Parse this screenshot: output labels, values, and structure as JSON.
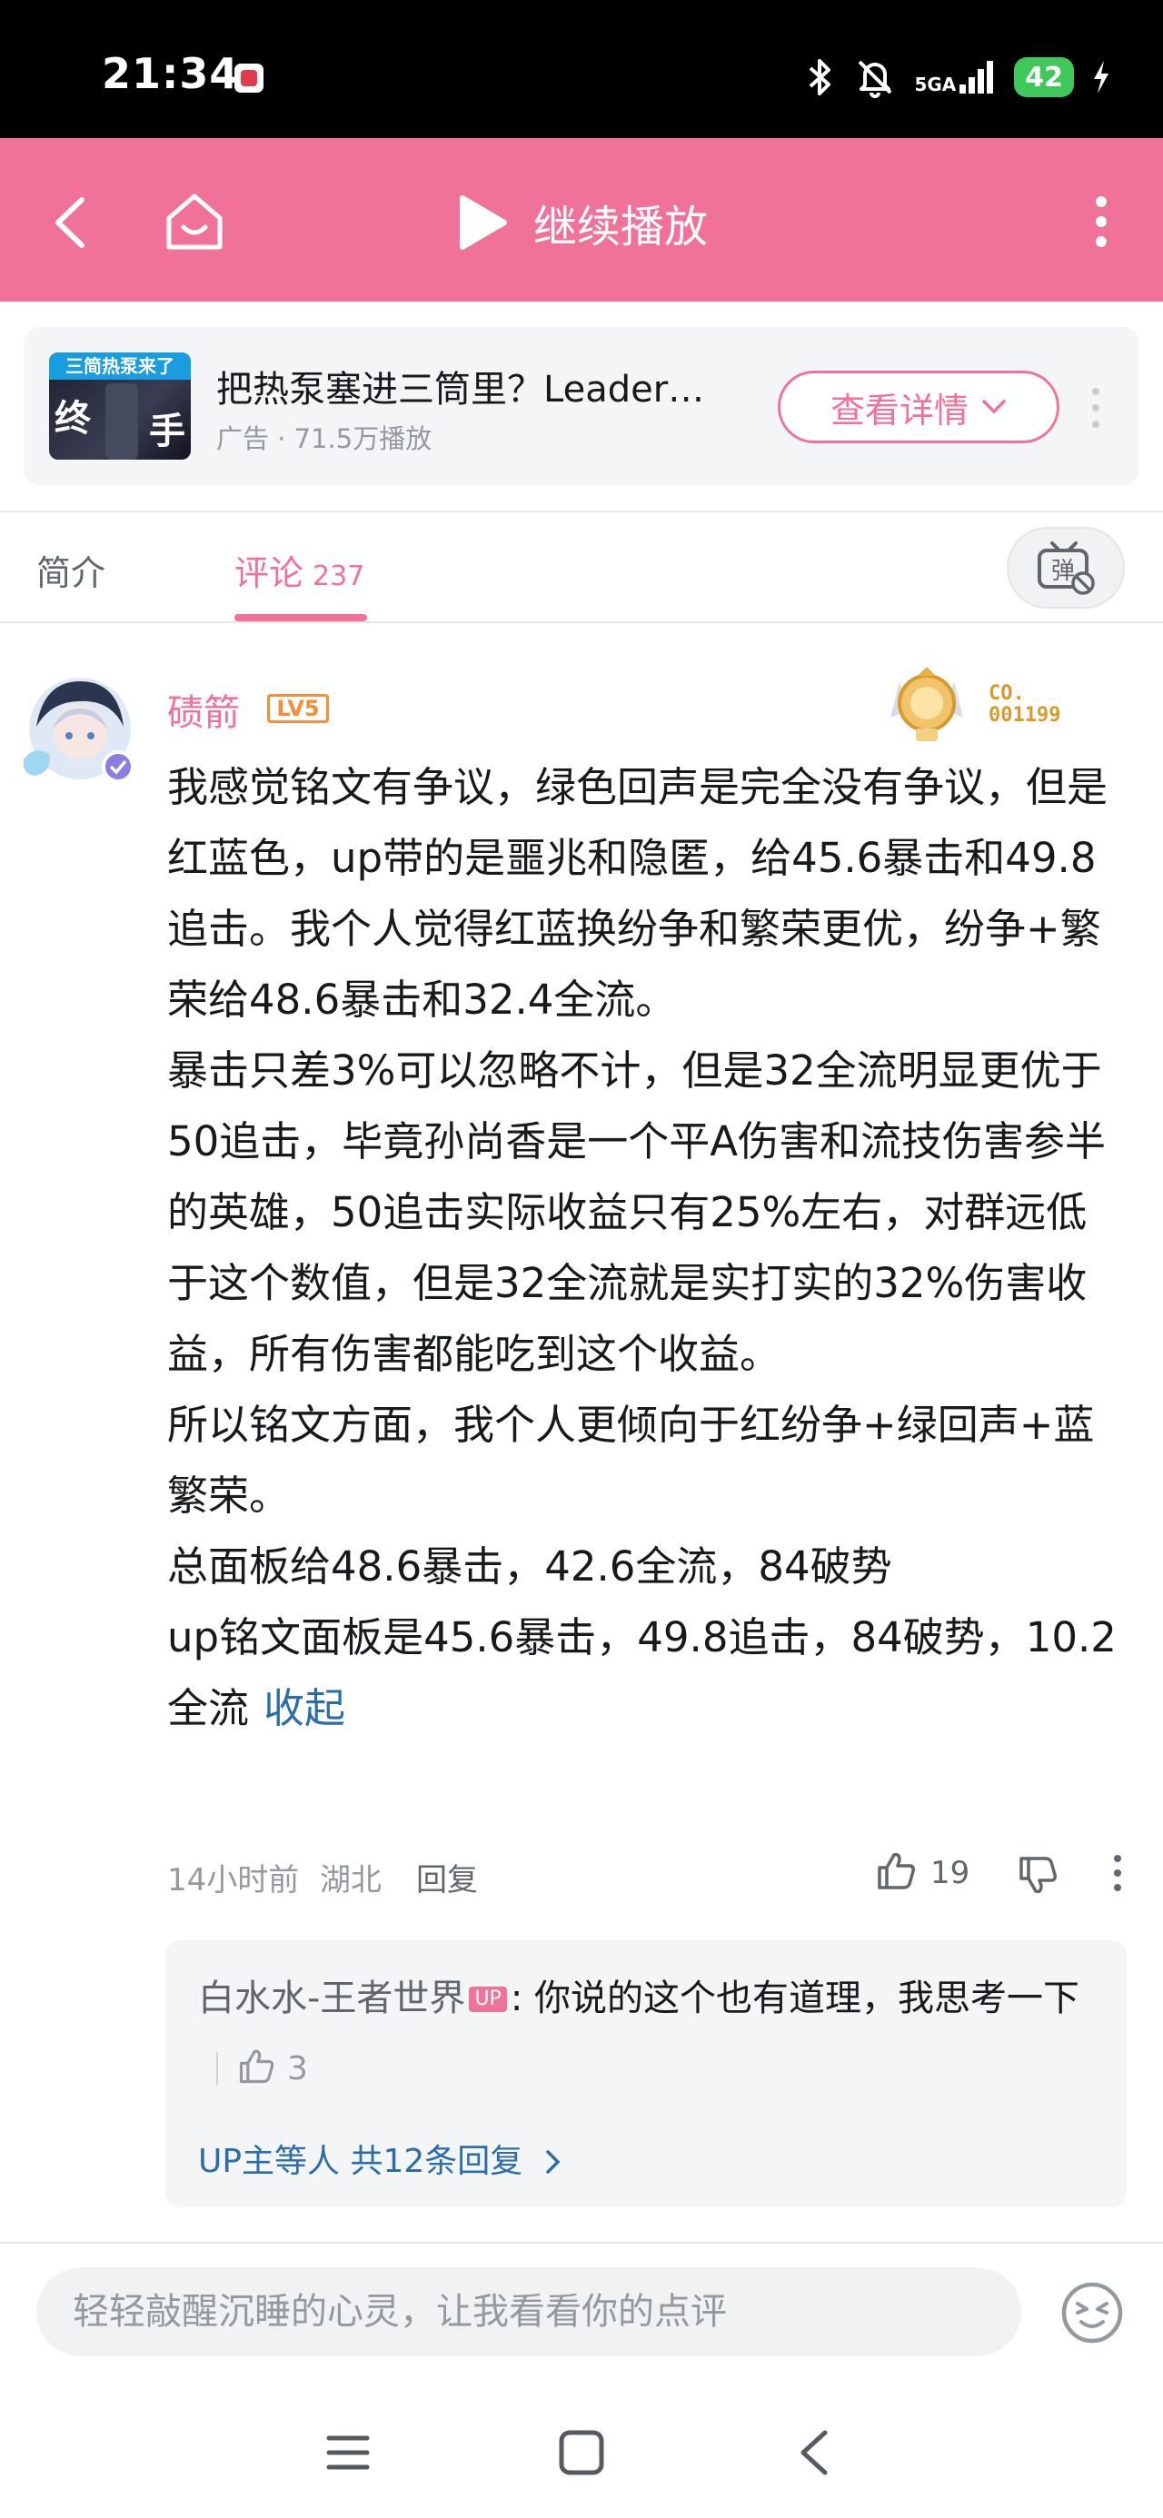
{
  "status_bar": {
    "time": "21:34",
    "network": "5GA",
    "battery": "42"
  },
  "nav_bar": {
    "title": "继续播放"
  },
  "ad": {
    "thumb_banner": "三简热泵来了",
    "thumb_left": "终",
    "thumb_right": "手",
    "title": "把热泵塞进三筒里？Leader…",
    "meta": "广告 · 71.5万播放",
    "button_label": "查看详情"
  },
  "tabs": {
    "intro": "简介",
    "comments": "评论",
    "comments_count": "237",
    "danmaku_glyph": "弹"
  },
  "comment": {
    "username": "碛箭",
    "level": "LV5",
    "medal_label": "CO.\n001199",
    "paragraphs": [
      "我感觉铭文有争议，绿色回声是完全没有争议，但是红蓝色，up带的是噩兆和隐匿，给45.6暴击和49.8追击。我个人觉得红蓝换纷争和繁荣更优，纷争+繁荣给48.6暴击和32.4全流。",
      "暴击只差3%可以忽略不计，但是32全流明显更优于50追击，毕竟孙尚香是一个平A伤害和流技伤害参半的英雄，50追击实际收益只有25%左右，对群远低于这个数值，但是32全流就是实打实的32%伤害收益，所有伤害都能吃到这个收益。",
      "所以铭文方面，我个人更倾向于红纷争+绿回声+蓝繁荣。",
      "总面板给48.6暴击，42.6全流，84破势",
      "up铭文面板是45.6暴击，49.8追击，84破势，10.2全流"
    ],
    "collapse_label": "收起",
    "time": "14小时前",
    "location": "湖北",
    "reply_label": "回复",
    "like_count": "19"
  },
  "reply": {
    "user": "白水水-王者世界",
    "up_badge": "UP",
    "text": ": 你说的这个也有道理，我思考一下",
    "like_count": "3",
    "view_more": "UP主等人 共12条回复"
  },
  "input": {
    "placeholder": "轻轻敲醒沉睡的心灵，让我看看你的点评"
  },
  "colors": {
    "brand_pink": "#f07299",
    "link_blue": "#2a6da8",
    "level_orange": "#f58e3a",
    "status_green": "#3fc95a"
  }
}
